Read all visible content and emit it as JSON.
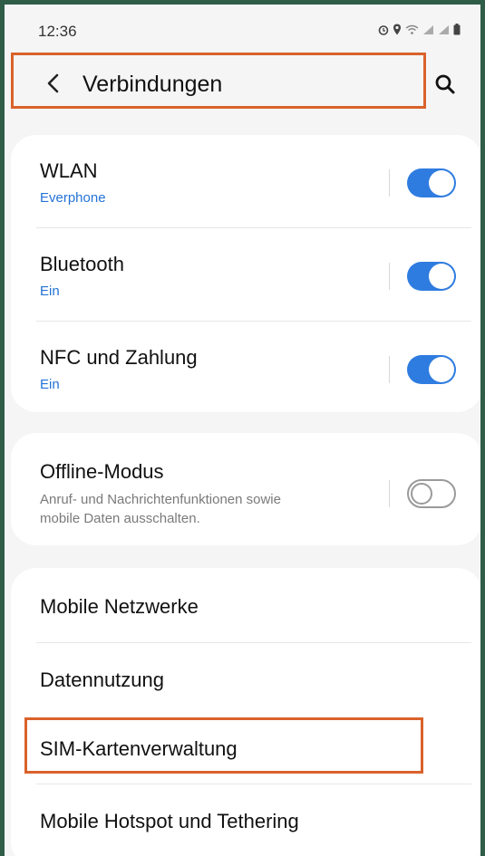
{
  "status": {
    "time": "12:36"
  },
  "header": {
    "title": "Verbindungen"
  },
  "group1": [
    {
      "title": "WLAN",
      "subtitle": "Everphone",
      "toggle": "on"
    },
    {
      "title": "Bluetooth",
      "subtitle": "Ein",
      "toggle": "on"
    },
    {
      "title": "NFC und Zahlung",
      "subtitle": "Ein",
      "toggle": "on"
    }
  ],
  "group2": {
    "title": "Offline-Modus",
    "description_line1": "Anruf- und Nachrichtenfunktionen sowie",
    "description_line2": "mobile Daten ausschalten.",
    "toggle": "off"
  },
  "group3": [
    {
      "title": "Mobile Netzwerke"
    },
    {
      "title": "Datennutzung"
    },
    {
      "title": "SIM-Kartenverwaltung"
    },
    {
      "title": "Mobile Hotspot und Tethering"
    }
  ],
  "colors": {
    "accent": "#2f7ce0",
    "highlight": "#d9622b",
    "subtitle": "#2473d6"
  }
}
